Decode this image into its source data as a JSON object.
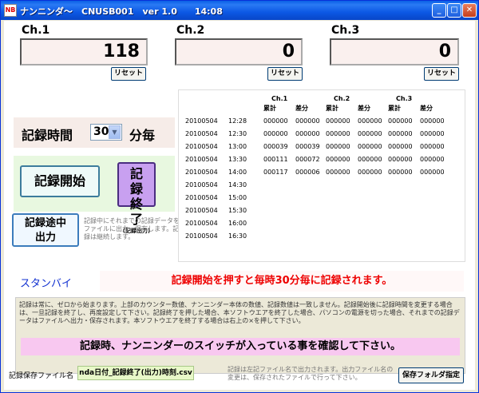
{
  "window": {
    "title": "ナンニンダ〜　CNUSB001　ver 1.0　　14:08",
    "icon_text": "NB"
  },
  "channels": [
    {
      "label": "Ch.1",
      "value": "118",
      "reset": "リセット"
    },
    {
      "label": "Ch.2",
      "value": "0",
      "reset": "リセット"
    },
    {
      "label": "Ch.3",
      "value": "0",
      "reset": "リセット"
    }
  ],
  "interval": {
    "label": "記録時間",
    "value": "30",
    "unit": "分毎"
  },
  "controls": {
    "start": "記録開始",
    "end": "記録終了",
    "end_sub": "(記録出力)",
    "mid": "記録途中出力",
    "mid_note": "記録中にそれまでの記録データをファイルに出力・保存します。記録は継続します。"
  },
  "log": {
    "channels": [
      "Ch.1",
      "Ch.2",
      "Ch.3"
    ],
    "subheaders": [
      "累計",
      "差分",
      "累計",
      "差分",
      "累計",
      "差分"
    ],
    "rows": [
      {
        "date": "20100504",
        "time": "12:28",
        "values": [
          "000000",
          "000000",
          "000000",
          "000000",
          "000000",
          "000000"
        ]
      },
      {
        "date": "20100504",
        "time": "12:30",
        "values": [
          "000000",
          "000000",
          "000000",
          "000000",
          "000000",
          "000000"
        ]
      },
      {
        "date": "20100504",
        "time": "13:00",
        "values": [
          "000039",
          "000039",
          "000000",
          "000000",
          "000000",
          "000000"
        ]
      },
      {
        "date": "20100504",
        "time": "13:30",
        "values": [
          "000111",
          "000072",
          "000000",
          "000000",
          "000000",
          "000000"
        ]
      },
      {
        "date": "20100504",
        "time": "14:00",
        "values": [
          "000117",
          "000006",
          "000000",
          "000000",
          "000000",
          "000000"
        ]
      },
      {
        "date": "20100504",
        "time": "14:30",
        "values": []
      },
      {
        "date": "20100504",
        "time": "15:00",
        "values": []
      },
      {
        "date": "20100504",
        "time": "15:30",
        "values": []
      },
      {
        "date": "20100504",
        "time": "16:00",
        "values": []
      },
      {
        "date": "20100504",
        "time": "16:30",
        "values": []
      }
    ]
  },
  "status": "スタンバイ",
  "notice": "記録開始を押すと毎時30分毎に記録されます。",
  "info": {
    "text": "記録は常に、ゼロから始まります。上部のカウンター数値、ナンニンダー本体の数値、記録数値は一致しません。記録開始後に記録時間を変更する場合は、一旦記録を終了し、再度設定して下さい。記録終了を押した場合、本ソフトウエアを終了した場合、パソコンの電源を切った場合、それまでの記録データはファイルへ出力・保存されます。本ソフトウエアを終了する場合は右上の×を押して下さい。",
    "warning": "記録時、ナンニンダーのスイッチが入っている事を確認して下さい。"
  },
  "file": {
    "label": "記録保存ファイル名",
    "name": "nda日付_記録終了(出力)時刻.csv",
    "note": "記録は左記ファイル名で出力されます。出力ファイル名の変更は、保存されたファイルで行って下さい。",
    "folder_button": "保存フォルダ指定"
  }
}
